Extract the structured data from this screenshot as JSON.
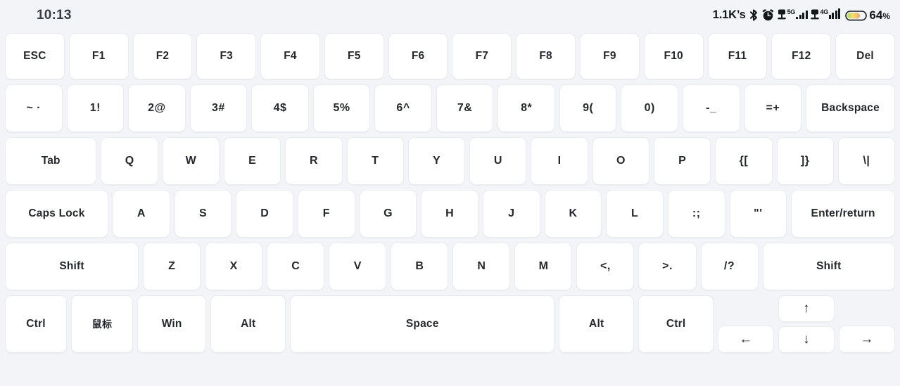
{
  "status_bar": {
    "clock": "10:13",
    "network_speed": "1.1K’s",
    "icons": [
      "bluetooth-icon",
      "alarm-clock-icon",
      "sim1-icon",
      "sim2-icon",
      "battery-icon"
    ],
    "sim1_network": "5G",
    "sim2_network": "4G",
    "sim1_signal_bars": 3,
    "sim2_signal_bars": 3,
    "battery_percent": "64",
    "battery_percent_unit": "%",
    "battery_level": 64,
    "colors": {
      "background": "#f2f4f7",
      "text": "#14171a",
      "battery_gradient_start": "#a8e063",
      "battery_gradient_mid": "#f7d774",
      "battery_gradient_end": "#f0a868"
    }
  },
  "keyboard": {
    "colors": {
      "key_background": "#ffffff",
      "key_border": "#e9ebee",
      "key_text": "#25282c",
      "board_background": "#f2f4f7"
    },
    "rows": [
      {
        "name": "function-row",
        "keys": [
          {
            "label": "ESC",
            "name": "key-esc",
            "flex": 1
          },
          {
            "label": "F1",
            "name": "key-f1",
            "flex": 1
          },
          {
            "label": "F2",
            "name": "key-f2",
            "flex": 1
          },
          {
            "label": "F3",
            "name": "key-f3",
            "flex": 1
          },
          {
            "label": "F4",
            "name": "key-f4",
            "flex": 1
          },
          {
            "label": "F5",
            "name": "key-f5",
            "flex": 1
          },
          {
            "label": "F6",
            "name": "key-f6",
            "flex": 1
          },
          {
            "label": "F7",
            "name": "key-f7",
            "flex": 1
          },
          {
            "label": "F8",
            "name": "key-f8",
            "flex": 1
          },
          {
            "label": "F9",
            "name": "key-f9",
            "flex": 1
          },
          {
            "label": "F10",
            "name": "key-f10",
            "flex": 1
          },
          {
            "label": "F11",
            "name": "key-f11",
            "flex": 1
          },
          {
            "label": "F12",
            "name": "key-f12",
            "flex": 1
          },
          {
            "label": "Del",
            "name": "key-del",
            "flex": 1
          }
        ]
      },
      {
        "name": "number-row",
        "keys": [
          {
            "label": "~ ·",
            "name": "key-tilde-backtick",
            "flex": 1
          },
          {
            "label": "1!",
            "name": "key-1",
            "flex": 1
          },
          {
            "label": "2@",
            "name": "key-2",
            "flex": 1
          },
          {
            "label": "3#",
            "name": "key-3",
            "flex": 1
          },
          {
            "label": "4$",
            "name": "key-4",
            "flex": 1
          },
          {
            "label": "5%",
            "name": "key-5",
            "flex": 1
          },
          {
            "label": "6^",
            "name": "key-6",
            "flex": 1
          },
          {
            "label": "7&",
            "name": "key-7",
            "flex": 1
          },
          {
            "label": "8*",
            "name": "key-8",
            "flex": 1
          },
          {
            "label": "9(",
            "name": "key-9",
            "flex": 1
          },
          {
            "label": "0)",
            "name": "key-0",
            "flex": 1
          },
          {
            "label": "-_",
            "name": "key-minus",
            "flex": 1
          },
          {
            "label": "=+",
            "name": "key-equals",
            "flex": 1
          },
          {
            "label": "Backspace",
            "name": "key-backspace",
            "flex": 1.57
          }
        ]
      },
      {
        "name": "qwerty-row",
        "keys": [
          {
            "label": "Tab",
            "name": "key-tab",
            "flex": 1.62
          },
          {
            "label": "Q",
            "name": "key-q",
            "flex": 1
          },
          {
            "label": "W",
            "name": "key-w",
            "flex": 1
          },
          {
            "label": "E",
            "name": "key-e",
            "flex": 1
          },
          {
            "label": "R",
            "name": "key-r",
            "flex": 1
          },
          {
            "label": "T",
            "name": "key-t",
            "flex": 1
          },
          {
            "label": "Y",
            "name": "key-y",
            "flex": 1
          },
          {
            "label": "U",
            "name": "key-u",
            "flex": 1
          },
          {
            "label": "I",
            "name": "key-i",
            "flex": 1
          },
          {
            "label": "O",
            "name": "key-o",
            "flex": 1
          },
          {
            "label": "P",
            "name": "key-p",
            "flex": 1
          },
          {
            "label": "{[",
            "name": "key-bracket-left",
            "flex": 1
          },
          {
            "label": "]}",
            "name": "key-bracket-right",
            "flex": 1
          },
          {
            "label": "\\|",
            "name": "key-backslash",
            "flex": 1
          }
        ]
      },
      {
        "name": "home-row",
        "keys": [
          {
            "label": "Caps Lock",
            "name": "key-caps-lock",
            "flex": 1.82
          },
          {
            "label": "A",
            "name": "key-a",
            "flex": 1
          },
          {
            "label": "S",
            "name": "key-s",
            "flex": 1
          },
          {
            "label": "D",
            "name": "key-d",
            "flex": 1
          },
          {
            "label": "F",
            "name": "key-f",
            "flex": 1
          },
          {
            "label": "G",
            "name": "key-g",
            "flex": 1
          },
          {
            "label": "H",
            "name": "key-h",
            "flex": 1
          },
          {
            "label": "J",
            "name": "key-j",
            "flex": 1
          },
          {
            "label": "K",
            "name": "key-k",
            "flex": 1
          },
          {
            "label": "L",
            "name": "key-l",
            "flex": 1
          },
          {
            "label": ":;",
            "name": "key-semicolon",
            "flex": 1
          },
          {
            "label": "\"'",
            "name": "key-quote",
            "flex": 1
          },
          {
            "label": "Enter/return",
            "name": "key-enter",
            "flex": 1.83
          }
        ]
      },
      {
        "name": "shift-row",
        "keys": [
          {
            "label": "Shift",
            "name": "key-shift-left",
            "flex": 2.35
          },
          {
            "label": "Z",
            "name": "key-z",
            "flex": 1
          },
          {
            "label": "X",
            "name": "key-x",
            "flex": 1
          },
          {
            "label": "C",
            "name": "key-c",
            "flex": 1
          },
          {
            "label": "V",
            "name": "key-v",
            "flex": 1
          },
          {
            "label": "B",
            "name": "key-b",
            "flex": 1
          },
          {
            "label": "N",
            "name": "key-n",
            "flex": 1
          },
          {
            "label": "M",
            "name": "key-m",
            "flex": 1
          },
          {
            "label": "<,",
            "name": "key-comma",
            "flex": 1
          },
          {
            "label": ">.",
            "name": "key-period",
            "flex": 1
          },
          {
            "label": "/?",
            "name": "key-slash",
            "flex": 1
          },
          {
            "label": "Shift",
            "name": "key-shift-right",
            "flex": 2.33
          }
        ]
      },
      {
        "name": "bottom-row",
        "keys": [
          {
            "label": "Ctrl",
            "name": "key-ctrl-left",
            "flex": 1
          },
          {
            "label": "鼠标",
            "name": "key-mouse",
            "flex": 1
          },
          {
            "label": "Win",
            "name": "key-win",
            "flex": 1.12
          },
          {
            "label": "Alt",
            "name": "key-alt-left",
            "flex": 1.22
          },
          {
            "label": "Space",
            "name": "key-space",
            "flex": 4.35
          },
          {
            "label": "Alt",
            "name": "key-alt-right",
            "flex": 1.22
          },
          {
            "label": "Ctrl",
            "name": "key-ctrl-right",
            "flex": 1.22
          }
        ],
        "arrow_keys": [
          {
            "label": "←",
            "name": "key-arrow-left"
          },
          {
            "label": "↑",
            "name": "key-arrow-up"
          },
          {
            "label": "↓",
            "name": "key-arrow-down"
          },
          {
            "label": "→",
            "name": "key-arrow-right"
          }
        ]
      }
    ]
  }
}
